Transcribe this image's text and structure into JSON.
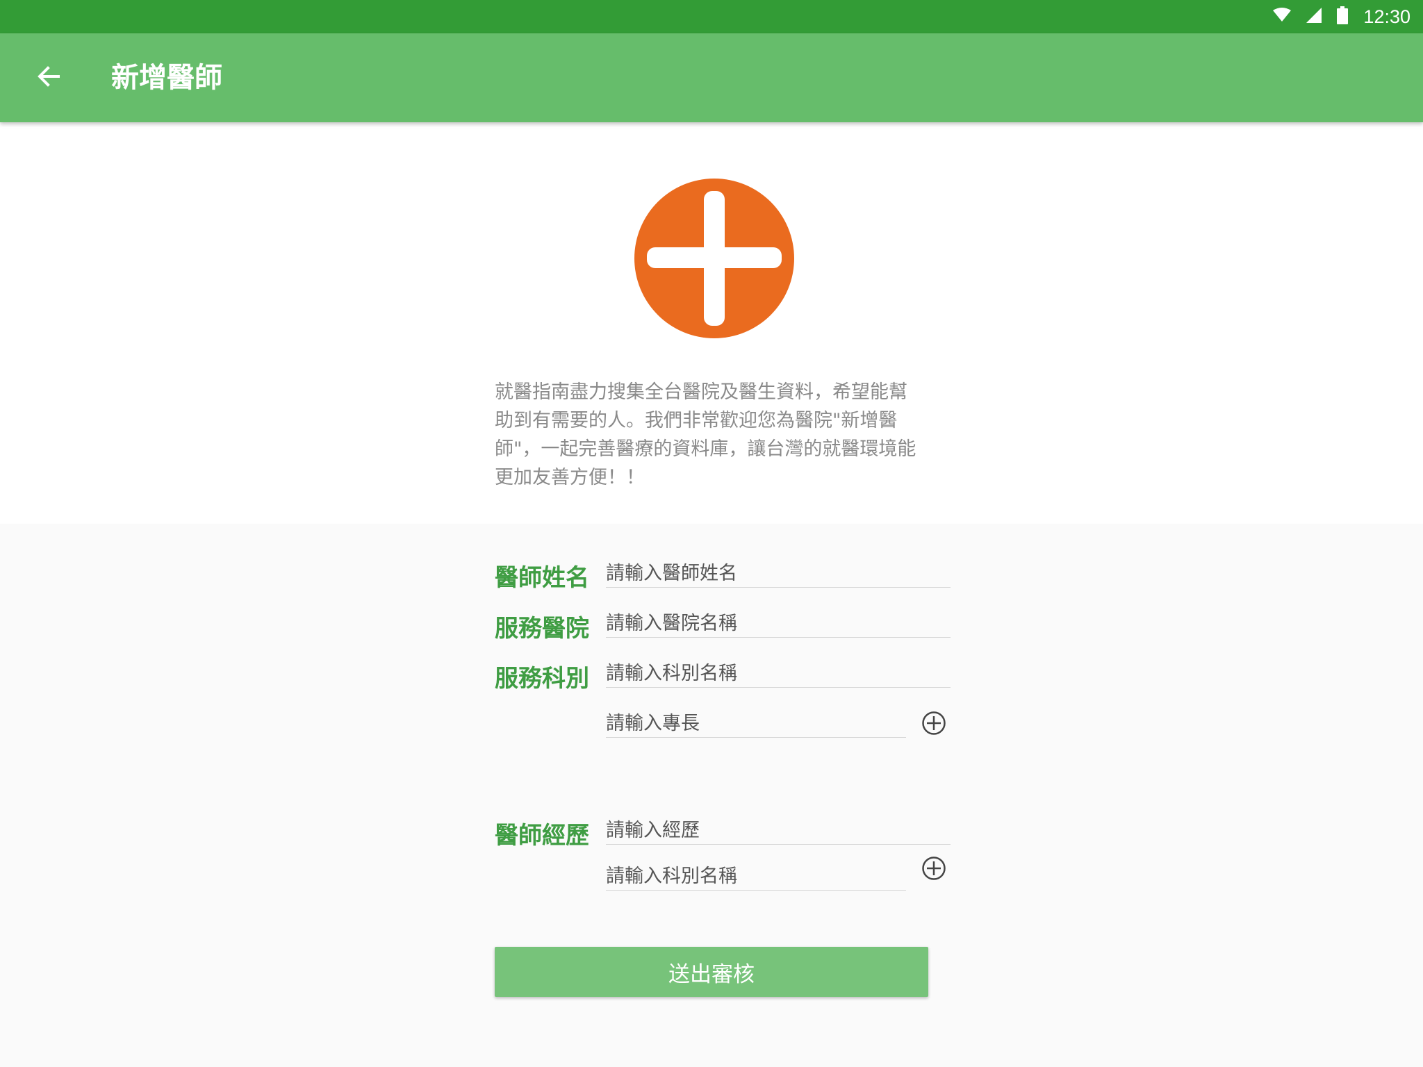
{
  "status_bar": {
    "time": "12:30",
    "icons": [
      "wifi-icon",
      "cellular-signal-icon",
      "battery-icon"
    ]
  },
  "app_bar": {
    "back_icon": "arrow-back-icon",
    "title": "新增醫師"
  },
  "intro": {
    "logo_icon": "medical-cross-logo",
    "text": "就醫指南盡力搜集全台醫院及醫生資料，希望能幫助到有需要的人。我們非常歡迎您為醫院\"新增醫師\"，一起完善醫療的資料庫，讓台灣的就醫環境能更加友善方便！！"
  },
  "form": {
    "doctor_name": {
      "label": "醫師姓名",
      "placeholder": "請輸入醫師姓名",
      "value": ""
    },
    "hospital": {
      "label": "服務醫院",
      "placeholder": "請輸入醫院名稱",
      "value": ""
    },
    "department": {
      "label": "服務科別",
      "placeholder": "請輸入科別名稱",
      "value": ""
    },
    "specialty": {
      "placeholder": "請輸入專長",
      "value": ""
    },
    "experience": {
      "label": "醫師經歷",
      "placeholder": "請輸入經歷",
      "value": ""
    },
    "experience_department": {
      "placeholder": "請輸入科別名稱",
      "value": ""
    },
    "add_icon": "add-circle-icon",
    "submit_label": "送出審核"
  },
  "colors": {
    "status_bar": "#339c36",
    "app_bar": "#66bd6b",
    "label_green": "#3f9d43",
    "logo_orange": "#ea6b1f",
    "submit_button": "#77c37a"
  }
}
